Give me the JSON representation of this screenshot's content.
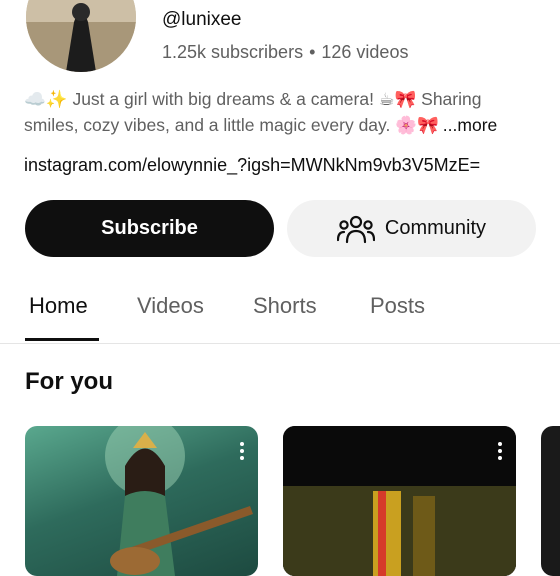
{
  "channel": {
    "handle": "@lunixee",
    "subscribers": "1.25k subscribers",
    "separator": "•",
    "videos": "126 videos",
    "description_line1": "☁️✨ Just a girl with big dreams & a camera! ☕🎀 Sharing",
    "description_line2": "smiles, cozy vibes, and a little magic every day. 🌸🎀",
    "more_label": "...more",
    "link": "instagram.com/elowynnie_?igsh=MWNkNm9vb3V5MzE="
  },
  "actions": {
    "subscribe_label": "Subscribe",
    "community_label": "Community"
  },
  "tabs": [
    {
      "label": "Home",
      "active": true
    },
    {
      "label": "Videos",
      "active": false
    },
    {
      "label": "Shorts",
      "active": false
    },
    {
      "label": "Posts",
      "active": false
    }
  ],
  "section": {
    "title": "For you"
  },
  "icons": {
    "community": "people-icon",
    "menu": "kebab-menu-icon"
  },
  "colors": {
    "primary_button": "#0f0f0f",
    "secondary_button": "#f2f2f2",
    "muted_text": "#606060"
  }
}
